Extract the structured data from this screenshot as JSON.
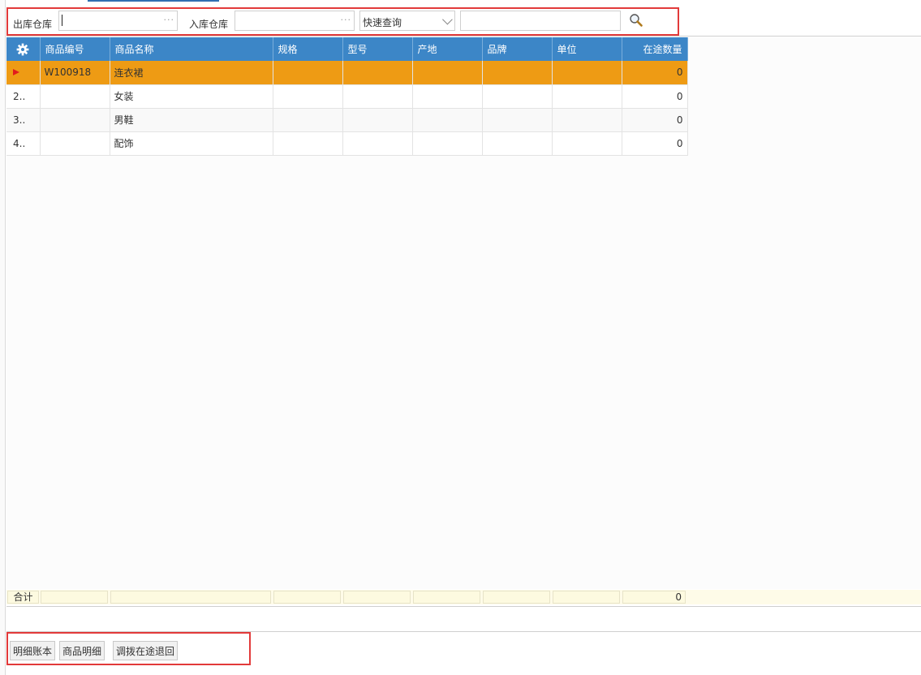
{
  "filters": {
    "outbound_label": "出库仓库",
    "outbound_value": "",
    "inbound_label": "入库仓库",
    "inbound_value": "",
    "quick_query": "快速查询",
    "search_value": "",
    "ellipsis": "···"
  },
  "grid": {
    "columns": [
      "商品编号",
      "商品名称",
      "规格",
      "型号",
      "产地",
      "品牌",
      "单位",
      "在途数量"
    ],
    "rows": [
      {
        "no": "",
        "code": "W100918",
        "name": "连衣裙",
        "spec": "",
        "model": "",
        "origin": "",
        "brand": "",
        "unit": "",
        "qty": "0"
      },
      {
        "no": "2..",
        "code": "",
        "name": "女装",
        "spec": "",
        "model": "",
        "origin": "",
        "brand": "",
        "unit": "",
        "qty": "0"
      },
      {
        "no": "3..",
        "code": "",
        "name": "男鞋",
        "spec": "",
        "model": "",
        "origin": "",
        "brand": "",
        "unit": "",
        "qty": "0"
      },
      {
        "no": "4..",
        "code": "",
        "name": "配饰",
        "spec": "",
        "model": "",
        "origin": "",
        "brand": "",
        "unit": "",
        "qty": "0"
      }
    ]
  },
  "totals": {
    "label": "合计",
    "qty": "0"
  },
  "buttons": {
    "ledger": "明细账本",
    "product_detail": "商品明细",
    "transfer_return": "调拨在途退回"
  },
  "colors": {
    "header": "#3c86c7",
    "selected_row": "#ee9b14",
    "highlight_border": "#e23a3a",
    "row_marker": "#e21c1c"
  },
  "icons": [
    "gear-icon",
    "search-icon",
    "chevron-down-icon",
    "row-pointer-icon"
  ]
}
